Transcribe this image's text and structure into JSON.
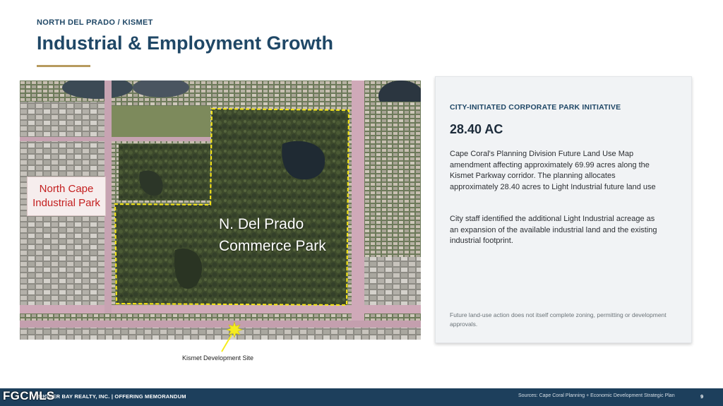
{
  "header": {
    "eyebrow": "NORTH DEL PRADO / KISMET",
    "title": "Industrial & Employment Growth"
  },
  "map": {
    "left_label_line1": "North Cape",
    "left_label_line2": "Industrial Park",
    "park_label_line1": "N. Del Prado",
    "park_label_line2": "Commerce Park",
    "boundary_color": "#f2e21a",
    "marker_color": "#f5ec1f"
  },
  "site_caption": "Kismet Development Site",
  "card": {
    "heading": "CITY-INITIATED CORPORATE PARK INITIATIVE",
    "stat": "28.40 AC",
    "paragraph1": "Cape Coral's Planning Division Future Land Use Map amendment affecting approximately 69.99 acres along the Kismet Parkway corridor. The planning allocates approximately 28.40 acres to Light Industrial future land use",
    "paragraph2": "City staff identified the additional Light Industrial acreage as an expansion of the available industrial land and the existing industrial footprint.",
    "note": "Future land-use action does not itself complete zoning, permitting or development approvals."
  },
  "footer": {
    "left_text": "MIGNER BAY REALTY, INC. | OFFERING MEMORANDUM",
    "sources": "Sources: Cape Coral Planning + Economic Development Strategic Plan",
    "page": "9",
    "accent": "#1d3f5c"
  },
  "watermark": "FGCMLS",
  "colors": {
    "title": "#1f4766",
    "rule": "#b79a5e",
    "label_red": "#c42020"
  }
}
